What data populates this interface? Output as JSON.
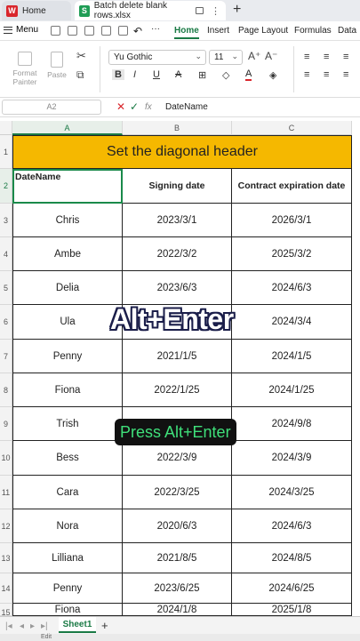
{
  "tabs": [
    {
      "label": "Home",
      "icon": "wps-icon"
    },
    {
      "label": "Batch delete blank rows.xlsx",
      "icon": "spreadsheet-icon"
    }
  ],
  "menu": {
    "menu_label": "Menu",
    "ribbon_tabs": [
      "Home",
      "Insert",
      "Page Layout",
      "Formulas",
      "Data"
    ],
    "active_tab": "Home"
  },
  "ribbon": {
    "format_painter": "Format\nPainter",
    "paste": "Paste",
    "font_name": "Yu Gothic",
    "font_size": "11"
  },
  "formula_bar": {
    "name_box": "A2",
    "value": "DateName"
  },
  "columns": [
    "A",
    "B",
    "C"
  ],
  "rows": [
    "1",
    "2",
    "3",
    "4",
    "5",
    "6",
    "7",
    "8",
    "9",
    "10",
    "11",
    "12",
    "13",
    "14",
    "15"
  ],
  "sheet": {
    "title": "Set the diagonal header",
    "a2": "DateName",
    "headers": [
      "Signing date",
      "Contract expiration date"
    ],
    "data": [
      [
        "Chris",
        "2023/3/1",
        "2026/3/1"
      ],
      [
        "Ambe",
        "2022/3/2",
        "2025/3/2"
      ],
      [
        "Delia",
        "2023/6/3",
        "2024/6/3"
      ],
      [
        "Ula",
        "",
        "2024/3/4"
      ],
      [
        "Penny",
        "2021/1/5",
        "2024/1/5"
      ],
      [
        "Fiona",
        "2022/1/25",
        "2024/1/25"
      ],
      [
        "Trish",
        "",
        "2024/9/8"
      ],
      [
        "Bess",
        "2022/3/9",
        "2024/3/9"
      ],
      [
        "Cara",
        "2022/3/25",
        "2024/3/25"
      ],
      [
        "Nora",
        "2020/6/3",
        "2024/6/3"
      ],
      [
        "Lilliana",
        "2021/8/5",
        "2024/8/5"
      ],
      [
        "Penny",
        "2023/6/25",
        "2024/6/25"
      ],
      [
        "Fiona",
        "2024/1/8",
        "2025/1/8"
      ]
    ]
  },
  "overlays": {
    "big_caption": "Alt+Enter",
    "small_caption": "Press Alt+Enter"
  },
  "bottom": {
    "sheet_tab": "Sheet1",
    "status": "Edit"
  },
  "colors": {
    "accent_green": "#1a7a45",
    "title_fill": "#f5b800",
    "caption_green": "#3fe07a"
  }
}
